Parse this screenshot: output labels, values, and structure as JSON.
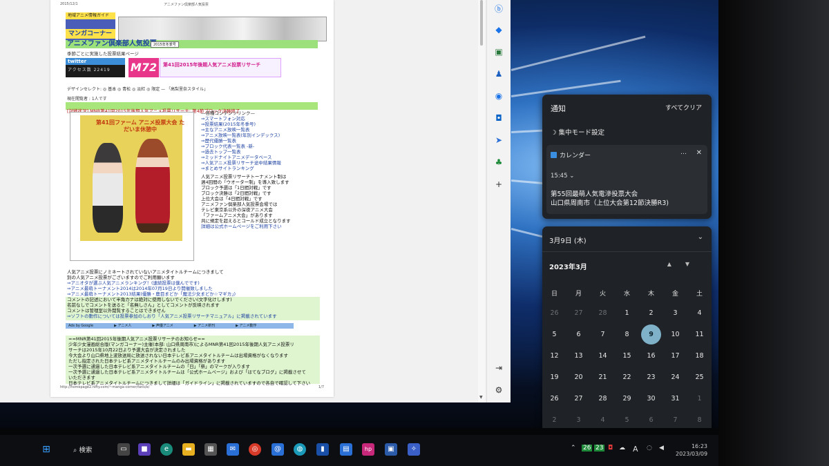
{
  "page": {
    "header_date": "2015/12/1",
    "header_title": "アニメファン倶楽部人気投票",
    "logo_top": "地域アニメ情報ガイド",
    "logo_main": "マンガコーナー",
    "title": "アニメファン倶楽部人気投票",
    "season_select": "2015年冬季号",
    "subtitle": "季節ごとに実施した投票結果ページ",
    "twitter_label": "twitter",
    "counter": "アクセス数 22419",
    "m72": "M72",
    "banner": "第41回2015年後期人気アニメ投票リサーチ",
    "design_select": "デザインセレクト: ◎ 基本 ◎ 青松 ◎ 淡紅 ◎ 限定 — 「高梨里奈スタイル」",
    "viewers": "現在閲覧者 : 1人です",
    "news_bar": "[対戦状況] MNR第41回2015年後期人気アニメ投票リサーチ: 第4節ブロック決勝終了",
    "illus_caption": "第41回ファーム アニメ投票大会 ただいま休憩中",
    "menu_items": [
      "—各種コンテンツリンク—",
      "⇒スマートフォン対応",
      "⇒投票結果(2015年冬季号)",
      "⇒主なアニメ放映一覧表",
      "⇒アニメ放映一覧表(年別インデックス)",
      "⇒歴代優勝一覧表",
      "⇒ブロック代表一覧表 -新-",
      "⇒過去トップ一覧表",
      "⇒ミッドナイトアニメデータベース",
      "⇒人気アニメ投票リサーチ途中結果情報",
      "⇒まとめサイトランキング"
    ],
    "info_lines": [
      "人気アニメ投票リサーチトーナメント制は",
      "週4回間の「ウオーター制」を導入致します",
      "ブロック予選は「1日間対戦」です",
      "ブロック決勝は「2日間対戦」です",
      "上位大会は「4日間対戦」です",
      "アニメファン倶楽部人気投票会場では",
      "テレビ東京系以外の深夜アニメ大会",
      "「ファームアニメ大会」があります",
      "共に規定を超えるとコールド成立となります",
      "詳細は公式ホームページをご利用下さい"
    ],
    "bottom_lines": [
      "人気アニメ投票にノミネートされていないアニメタイトルチームにつきまして",
      "別の人気アニメ投票がございますのでご利用願います",
      "⇒アニオタが選ぶ人気アニメランキング！(速続投票は僕んでです)",
      "⇒アニメ最萌トーナメント2014は2014年07月19日より開催致しました",
      "⇒アニメ最萌トーナメント2013結果(優勝・鹿目まどか「魔法少女まどか☆マギカ」)",
      "コメントの記述において半角カナは絶対に使用しないでください(文字化けします)",
      "名前なしでコメントを送ると「名無しさん」としてコメントが反映されます",
      "コメントは管理室以外閲覧することはできません",
      "⇒ソフトの動作については投票参加のしおり「人気アニメ投票リサーチマニュアル」に掲載されています"
    ],
    "ads_items": [
      "Ads by Google",
      "▶ アニメ人",
      "▶ 声優アニメ",
      "▶ アニメ新刊",
      "▶ アニメ動作"
    ],
    "notice_lines": [
      "==MNR第41回2015年後期人気アニメ投票リサーチのお知らせ==",
      "少年少女漫画総合版(マンガコーナー)主催(本部: 山口県周南市)によるMNR第41回2015年後期人気アニメ投票リ",
      "サーチは2015年10月22日より予選大会が決定されました",
      "今大会より山口県地上波放送局に放送されない日本テレビ系アニメタイトルチームは出場資格がなくなります",
      "ただし指定された日本テレビ系アニメタイトルチームのみ出場資格があります",
      "一次予選に通過した日本テレビ系アニメタイトルチームの「日」「祭」のマークが入ります",
      "一次予選に通過した日本テレビ系アニメタイトルチームは「公式ホームページ」および「はてなブログ」に掲載させて",
      "いただきます",
      "日本テレビ系アニメタイトルチームにつきまして詳細は「ガイドライン」に掲載されていますので各自で確認して下さい"
    ],
    "footer_url": "http://homepage2.nifty.com/~manga-corner/fans/e/",
    "footer_page": "1/7"
  },
  "notifications": {
    "title": "通知",
    "clear_all": "すべてクリア",
    "focus": "集中モード設定",
    "app": "カレンダー",
    "more": "…",
    "close": "✕",
    "time": "15:45",
    "event_title": "第55回最萌人気電滲投票大会",
    "event_detail": "山口県周南市（上位大会第12節決勝R3)"
  },
  "calendar": {
    "date_header": "3月9日 (木)",
    "month": "2023年3月",
    "weekdays": [
      "日",
      "月",
      "火",
      "水",
      "木",
      "金",
      "土"
    ],
    "weeks": [
      [
        "26",
        "27",
        "28",
        "1",
        "2",
        "3",
        "4"
      ],
      [
        "5",
        "6",
        "7",
        "8",
        "9",
        "10",
        "11"
      ],
      [
        "12",
        "13",
        "14",
        "15",
        "16",
        "17",
        "18"
      ],
      [
        "19",
        "20",
        "21",
        "22",
        "23",
        "24",
        "25"
      ],
      [
        "26",
        "27",
        "28",
        "29",
        "30",
        "31",
        "1"
      ],
      [
        "2",
        "3",
        "4",
        "5",
        "6",
        "7",
        "8"
      ]
    ],
    "selected": "9"
  },
  "taskbar": {
    "search": "検索",
    "tray_badges": [
      "26",
      "23"
    ],
    "ime": "A",
    "time": "16:23",
    "date": "2023/03/09"
  },
  "colors": {
    "accent": "#3a8fe0",
    "selected_day": "#7fb2c9",
    "panel_bg": "#1f2226"
  }
}
